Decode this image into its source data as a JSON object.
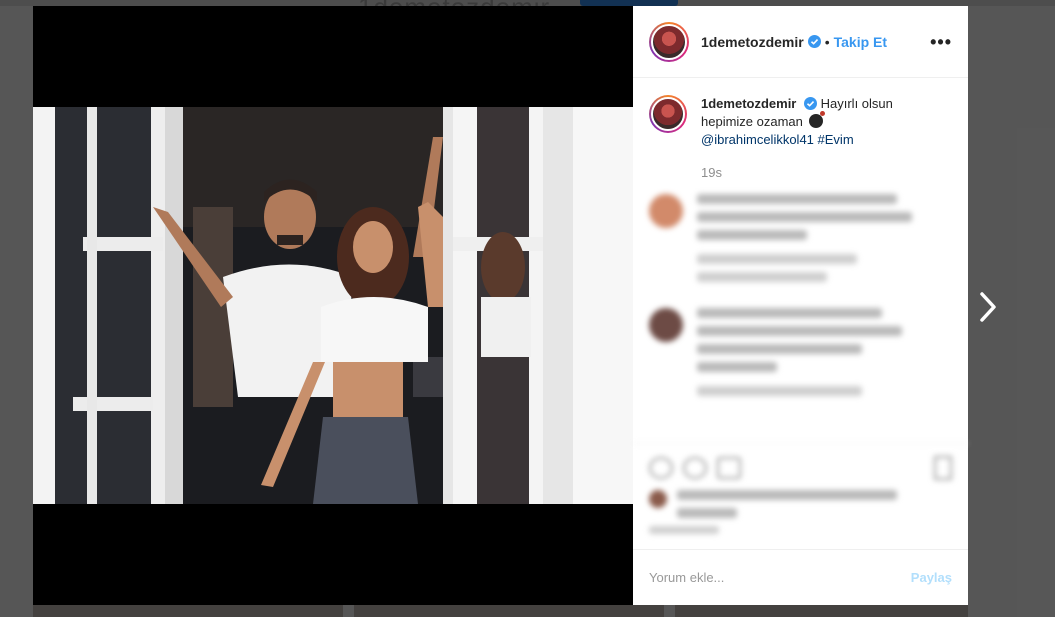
{
  "profile": {
    "username": "1demetozdemir",
    "follow_label": "Takip Et"
  },
  "post": {
    "username": "1demetozdemir",
    "separator": "•",
    "follow_label": "Takip Et",
    "more_icon": "more-dots-icon",
    "caption_text": "Hayırlı olsun hepimize ozaman",
    "caption_emoji": "bomb-emoji",
    "mention": "@ibrahimcelikkol41",
    "hashtag": "#Evim",
    "time": "19s"
  },
  "comment_box": {
    "placeholder": "Yorum ekle...",
    "share_label": "Paylaş"
  },
  "colors": {
    "accent": "#3897f0",
    "share_disabled": "#b2dffc",
    "verified": "#3897f0",
    "link": "#003569"
  }
}
